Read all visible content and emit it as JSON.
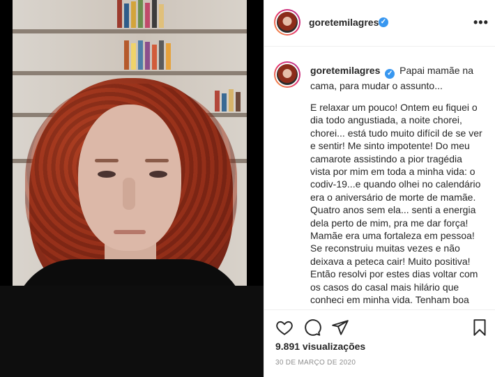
{
  "post": {
    "username": "goretemilagres",
    "verified": true,
    "more_label": "•••",
    "caption_title": "Papai mamãe na cama, para mudar o assunto...",
    "caption_body": "E relaxar um pouco! Ontem eu fiquei o dia todo angustiada, a noite chorei, chorei... está tudo muito difícil de se ver e sentir! Me sinto impotente! Do meu camarote assistindo a pior tragédia vista por mim em toda a minha vida: o codiv-19...e quando olhei no calendário era o aniversário de morte de mamãe. Quatro anos sem ela... senti a energia dela perto de mim, pra me dar força! Mamãe era uma fortaleza em pessoa! Se reconstruiu muitas vezes e não deixava a peteca cair! Muito positiva! Então resolvi por estes dias voltar com os casos do casal mais hilário que conheci em minha vida. Tenham boa quarentena!",
    "views": "9.891 visualizações",
    "date": "30 DE MARÇO DE 2020"
  },
  "icons": {
    "like": "heart-icon",
    "comment": "comment-icon",
    "share": "share-icon",
    "save": "bookmark-icon",
    "verified": "verified-badge-icon"
  },
  "colors": {
    "accent": "#3897f0",
    "text": "#262626",
    "muted": "#8e8e8e",
    "hair": "#8e2e1a"
  }
}
